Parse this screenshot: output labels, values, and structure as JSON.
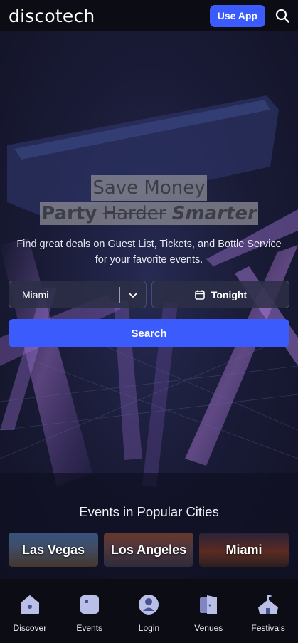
{
  "header": {
    "logo": "discotech",
    "use_app_label": "Use App",
    "search_icon": "search-icon"
  },
  "hero": {
    "headline_line1": "Save Money",
    "headline_party": "Party",
    "headline_harder": "Harder",
    "headline_smarter": "Smarter",
    "subtitle": "Find great deals on Guest List, Tickets, and Bottle Service for your favorite events.",
    "city_select": {
      "value": "Miami",
      "icon": "chevron-down-icon"
    },
    "date_button": {
      "label": "Tonight",
      "icon": "calendar-icon"
    },
    "search_label": "Search"
  },
  "popular": {
    "title": "Events in Popular Cities",
    "cities": [
      {
        "label": "Las Vegas"
      },
      {
        "label": "Los Angeles"
      },
      {
        "label": "Miami"
      }
    ]
  },
  "bottom_nav": {
    "items": [
      {
        "label": "Discover",
        "icon": "discover-icon"
      },
      {
        "label": "Events",
        "icon": "events-icon"
      },
      {
        "label": "Login",
        "icon": "user-icon"
      },
      {
        "label": "Venues",
        "icon": "venues-icon"
      },
      {
        "label": "Festivals",
        "icon": "festivals-icon"
      }
    ]
  },
  "colors": {
    "accent": "#3b5bfd",
    "header_bg": "#0b0c14",
    "nav_icon": "#b9bfe6"
  }
}
